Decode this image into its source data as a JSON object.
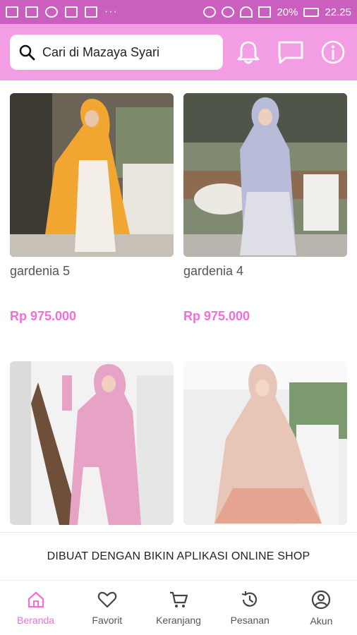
{
  "statusbar": {
    "battery": "20%",
    "time": "22.25",
    "dots": "···"
  },
  "search": {
    "placeholder": "Cari di Mazaya Syari"
  },
  "products": [
    {
      "name": "gardenia 5",
      "price": "Rp 975.000"
    },
    {
      "name": "gardenia 4",
      "price": "Rp 975.000"
    },
    {
      "name": "",
      "price": ""
    },
    {
      "name": "",
      "price": ""
    }
  ],
  "banner": {
    "text": "DIBUAT DENGAN BIKIN APLIKASI ONLINE SHOP"
  },
  "nav": [
    {
      "label": "Beranda",
      "icon": "home-icon",
      "active": true
    },
    {
      "label": "Favorit",
      "icon": "heart-icon"
    },
    {
      "label": "Keranjang",
      "icon": "cart-icon"
    },
    {
      "label": "Pesanan",
      "icon": "history-icon"
    },
    {
      "label": "Akun",
      "icon": "account-icon"
    }
  ],
  "colors": {
    "header": "#f39ee4",
    "statusbar": "#ca5fc0",
    "accent": "#f16fd7"
  }
}
